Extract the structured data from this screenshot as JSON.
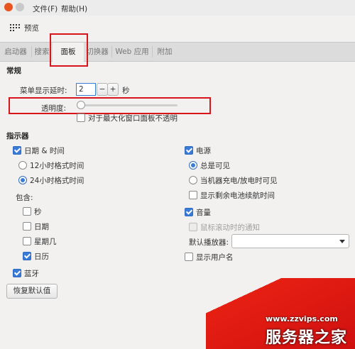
{
  "menubar": {
    "file": "文件(F)",
    "help": "帮助(H)"
  },
  "toolbar": {
    "preview": "预览"
  },
  "tabs": [
    "启动器",
    "搜索",
    "面板",
    "切换器",
    "Web 应用",
    "附加"
  ],
  "general": {
    "title": "常规",
    "menu_delay_label": "菜单显示延时:",
    "menu_delay_value": "2",
    "minus": "−",
    "plus": "+",
    "unit": "秒",
    "opacity_label": "透明度:",
    "opacity_value": 0.0,
    "no_opacity_max": "对于最大化窗口面板不透明"
  },
  "indicators": {
    "title": "指示器",
    "datetime": "日期 & 时间",
    "h12": "12小时格式时间",
    "h24": "24小时格式时间",
    "include": "包含:",
    "seconds": "秒",
    "date": "日期",
    "weekday": "星期几",
    "calendar": "日历",
    "bluetooth": "蓝牙",
    "power": "电源",
    "always_visible": "总是可见",
    "when_charging": "当机器充电/放电时可见",
    "show_battery_time": "显示剩余电池续航时间",
    "sound": "音量",
    "scroll_notify": "鼠标滚动时的通知",
    "default_player": "默认播放器:",
    "show_username": "显示用户名"
  },
  "restore_defaults": "恢复默认值",
  "watermark": {
    "url": "www.zzvips.com",
    "name": "服务器之家"
  },
  "colors": {
    "accent": "#3a7bd5",
    "highlight": "#d8151c",
    "close": "#e95420"
  }
}
